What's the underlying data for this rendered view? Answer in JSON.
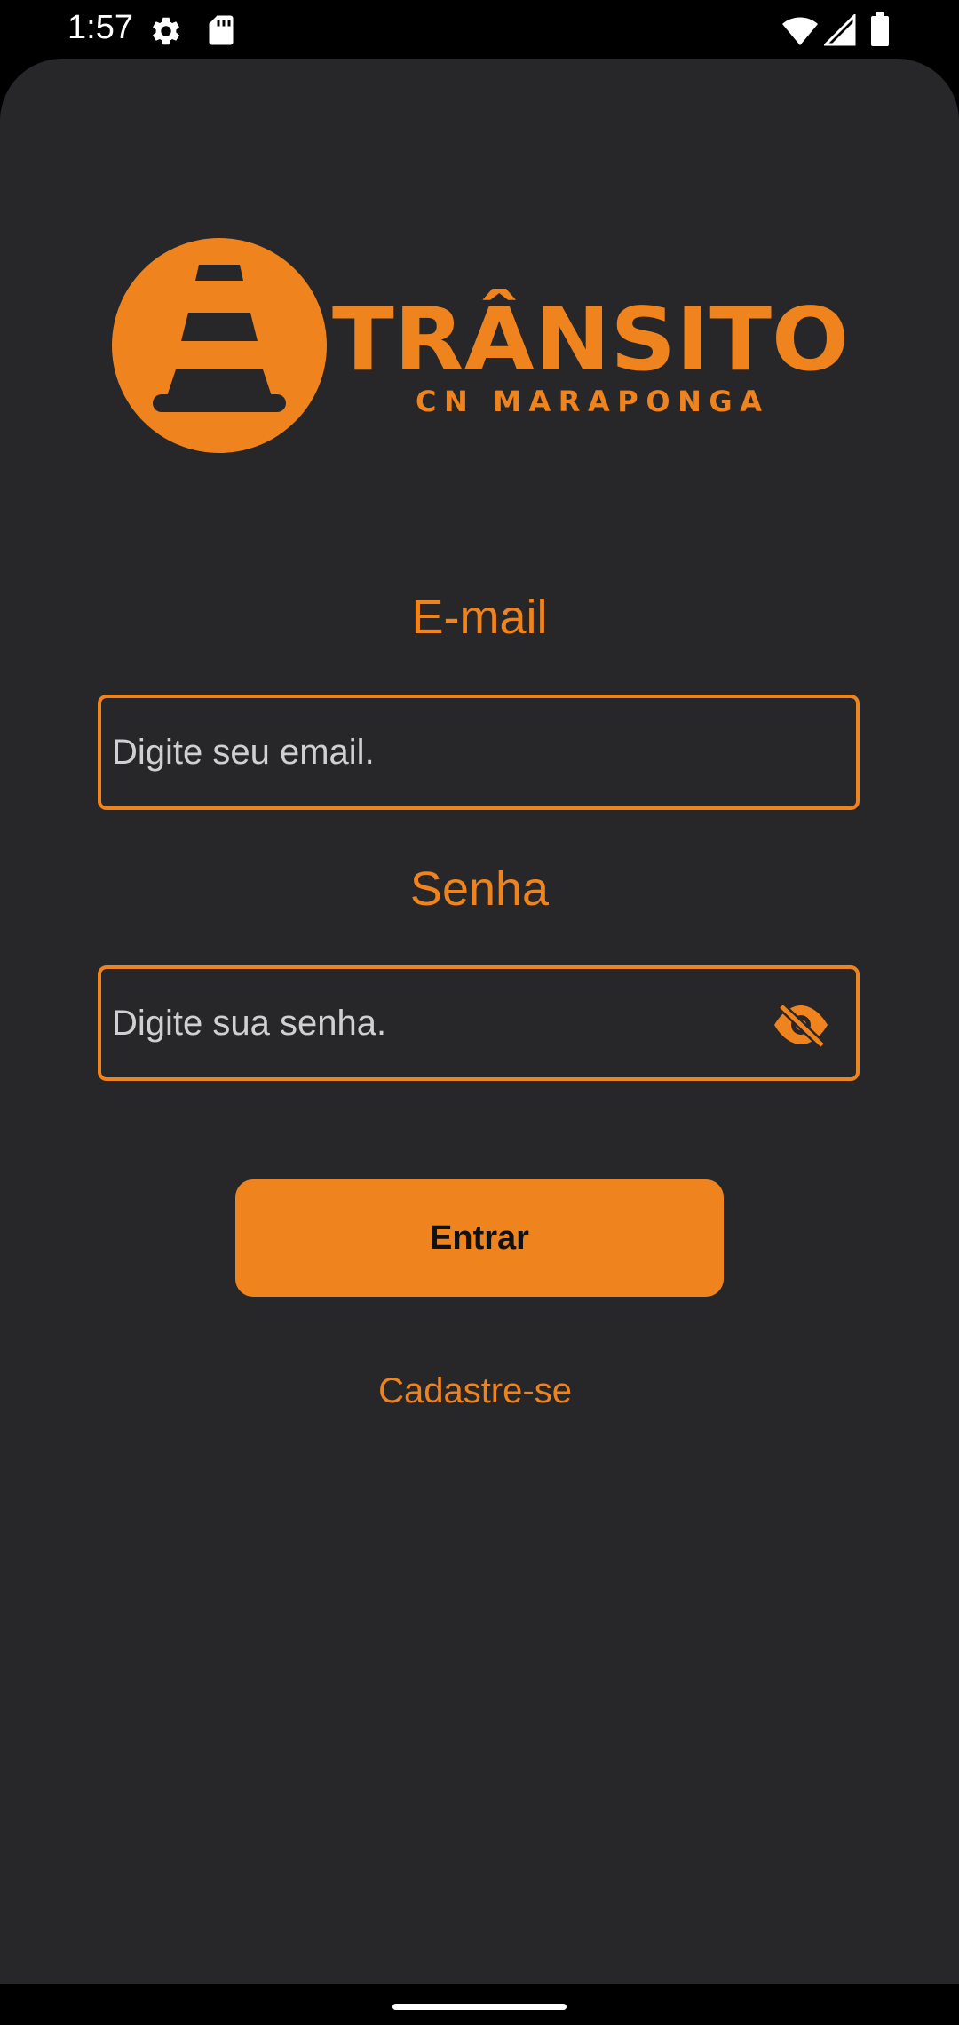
{
  "status_bar": {
    "time": "1:57",
    "icons": [
      "settings-gear-icon",
      "sd-card-icon",
      "wifi-icon",
      "signal-icon",
      "battery-icon"
    ]
  },
  "logo": {
    "title": "TRÂNSITO",
    "subtitle": "CN MARAPONGA",
    "icon": "traffic-cone-icon",
    "color": "#ef831e"
  },
  "form": {
    "email": {
      "label": "E-mail",
      "placeholder": "Digite seu email.",
      "value": ""
    },
    "password": {
      "label": "Senha",
      "placeholder": "Digite sua senha.",
      "value": "",
      "toggle_icon": "eye-off-icon"
    },
    "submit_label": "Entrar",
    "signup_label": "Cadastre-se"
  },
  "colors": {
    "accent": "#ef831e",
    "background": "#272729",
    "status_bar": "#000000",
    "button_text": "#111111"
  }
}
